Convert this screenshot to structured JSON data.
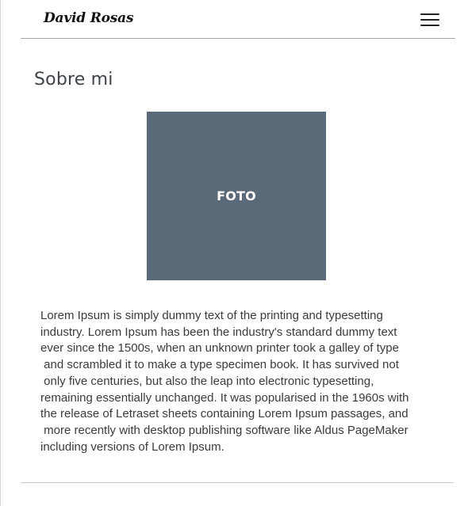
{
  "header": {
    "brand": "David Rosas",
    "menu_icon": "hamburger-menu-icon"
  },
  "about": {
    "title": "Sobre mi",
    "photo_label": "FOTO",
    "paragraph": "Lorem Ipsum is simply dummy text of the printing and typesetting\nindustry. Lorem Ipsum has been the industry's standard dummy text\never since the 1500s, when an unknown printer took a galley of type\n and scrambled it to make a type specimen book. It has survived not\n only five centuries, but also the leap into electronic typesetting,\nremaining essentially unchanged. It was popularised in the 1960s with\nthe release of Letraset sheets containing Lorem Ipsum passages, and\n more recently with desktop publishing software like Aldus PageMaker\nincluding versions of Lorem Ipsum."
  },
  "colors": {
    "photo_background": "#5b6a78",
    "header_rule": "#a7a7a7",
    "title": "#3d4349"
  }
}
